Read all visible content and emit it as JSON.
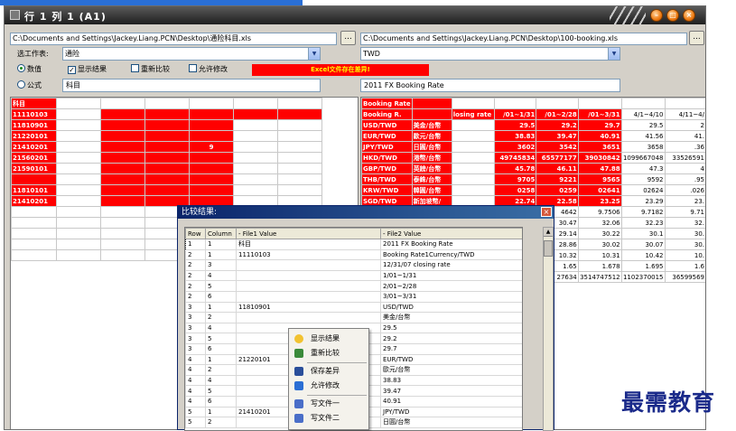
{
  "window": {
    "title": "行 1 列 1 (A1)"
  },
  "left": {
    "path": "C:\\Documents and Settings\\Jackey.Liang.PCN\\Desktop\\通险科目.xls",
    "browse": "...",
    "sheet_label": "选工作表:",
    "sheet_value": "通险",
    "mode_value": "数值",
    "mode_formula": "公式",
    "formula_text": "科目"
  },
  "right": {
    "path": "C:\\Documents and Settings\\Jackey.Liang.PCN\\Desktop\\100-booking.xls",
    "browse": "...",
    "sheet_value": "TWD",
    "formula_text": "2011 FX Booking Rate"
  },
  "options": {
    "show_result": "显示结果",
    "recompare": "重新比较",
    "allow_edit": "允许修改",
    "banner": "Excel文件存在差异!"
  },
  "left_grid": {
    "rows": [
      [
        "科目",
        "",
        "",
        "",
        "",
        "",
        ""
      ],
      [
        "11110103",
        "",
        "",
        "",
        "",
        "",
        ""
      ],
      [
        "11810901",
        "",
        "",
        "",
        "",
        "",
        ""
      ],
      [
        "21220101",
        "",
        "",
        "",
        "",
        "",
        ""
      ],
      [
        "21410201",
        "",
        "",
        "",
        "9",
        "",
        ""
      ],
      [
        "21560201",
        "",
        "",
        "",
        "",
        "",
        ""
      ],
      [
        "21590101",
        "",
        "",
        "",
        "",
        "",
        ""
      ],
      [
        "",
        "",
        "",
        "",
        "",
        "",
        ""
      ],
      [
        "11810101",
        "",
        "",
        "",
        "",
        "",
        ""
      ],
      [
        "21410201",
        "",
        "",
        "",
        "",
        "",
        ""
      ],
      [
        "",
        "",
        "",
        "",
        "",
        "",
        ""
      ],
      [
        "",
        "",
        "",
        "",
        "",
        "",
        ""
      ],
      [
        "",
        "",
        "",
        "",
        "",
        "",
        ""
      ],
      [
        "",
        "",
        "",
        "",
        "",
        "",
        ""
      ],
      [
        "",
        "",
        "",
        "",
        "",
        "",
        ""
      ]
    ]
  },
  "right_grid": {
    "rows": [
      [
        "Booking Rate",
        "",
        "",
        "",
        "",
        "",
        "",
        ""
      ],
      [
        "Booking R.",
        "",
        "losing rate",
        "/01~1/31",
        "/01~2/28",
        "/01~3/31",
        "4/1~4/10",
        "4/11~4/"
      ],
      [
        "USD/TWD",
        "美金/台幣",
        "",
        "29.5",
        "29.2",
        "29.7",
        "29.5",
        "2"
      ],
      [
        "EUR/TWD",
        "歐元/台幣",
        "",
        "38.83",
        "39.47",
        "40.91",
        "41.56",
        "41."
      ],
      [
        "JPY/TWD",
        "日圓/台幣",
        "",
        "3602",
        "3542",
        "3651",
        "3658",
        ".36"
      ],
      [
        "HKD/TWD",
        "港幣/台幣",
        "",
        "49745834",
        "65577177",
        "39030842",
        "1099667048",
        "33526591"
      ],
      [
        "GBP/TWD",
        "英鎊/台幣",
        "",
        "45.78",
        "46.11",
        "47.88",
        "47.3",
        "4"
      ],
      [
        "THB/TWD",
        "泰銖/台幣",
        "",
        "9705",
        "9221",
        "9565",
        "9592",
        ".95"
      ],
      [
        "KRW/TWD",
        "韓圓/台幣",
        "",
        "0258",
        "0259",
        "02641",
        "02624",
        ".026"
      ],
      [
        "SGD/TWD",
        "新加坡幣/",
        "",
        "22.74",
        "22.58",
        "23.25",
        "23.29",
        "23."
      ],
      [
        "",
        "",
        "",
        "",
        "4642",
        "9.7506",
        "9.7182",
        "9.71"
      ],
      [
        "",
        "",
        "",
        "",
        "30.47",
        "32.06",
        "32.23",
        "32."
      ],
      [
        "",
        "",
        "",
        "",
        "29.14",
        "30.22",
        "30.1",
        "30."
      ],
      [
        "",
        "",
        "",
        "",
        "28.86",
        "30.02",
        "30.07",
        "30."
      ],
      [
        "",
        "",
        "",
        "",
        "10.32",
        "10.31",
        "10.42",
        "10."
      ],
      [
        "",
        "",
        "",
        "",
        "1.65",
        "1.678",
        "1.695",
        "1.6"
      ],
      [
        "",
        "",
        "",
        "",
        "27634",
        "3514747512",
        "1102370015",
        "36599569"
      ]
    ]
  },
  "dialog": {
    "title": "比较结果:",
    "close": "×",
    "columns": [
      "Row",
      "Column",
      "-      File1 Value",
      "-      File2 Value"
    ],
    "rows": [
      [
        "1",
        "1",
        "科目",
        "2011 FX Booking Rate"
      ],
      [
        "2",
        "1",
        "11110103",
        "Booking Rate1Currency/TWD"
      ],
      [
        "2",
        "3",
        "",
        "12/31/07 closing rate"
      ],
      [
        "2",
        "4",
        "",
        "1/01~1/31"
      ],
      [
        "2",
        "5",
        "",
        "2/01~2/28"
      ],
      [
        "2",
        "6",
        "",
        "3/01~3/31"
      ],
      [
        "3",
        "1",
        "11810901",
        "USD/TWD"
      ],
      [
        "3",
        "2",
        "",
        "美金/台幣"
      ],
      [
        "3",
        "4",
        "",
        "29.5"
      ],
      [
        "3",
        "5",
        "",
        "29.2"
      ],
      [
        "3",
        "6",
        "",
        "29.7"
      ],
      [
        "4",
        "1",
        "21220101",
        "EUR/TWD"
      ],
      [
        "4",
        "2",
        "",
        "歐元/台幣"
      ],
      [
        "4",
        "4",
        "",
        "38.83"
      ],
      [
        "4",
        "5",
        "",
        "39.47"
      ],
      [
        "4",
        "6",
        "",
        "40.91"
      ],
      [
        "5",
        "1",
        "21410201",
        "JPY/TWD"
      ],
      [
        "5",
        "2",
        "",
        "日圓/台幣"
      ]
    ]
  },
  "context_menu": {
    "show_result": "显示结果",
    "recompare": "重新比较",
    "save_diff": "保存差异",
    "allow_edit": "允许修改",
    "write_file1": "写文件一",
    "write_file2": "写文件二"
  },
  "watermark": "最需教育",
  "colors": {
    "diff_red": "#ff0000",
    "title_dark": "#1e1e1e",
    "dialog_blue": "#0a246a"
  }
}
